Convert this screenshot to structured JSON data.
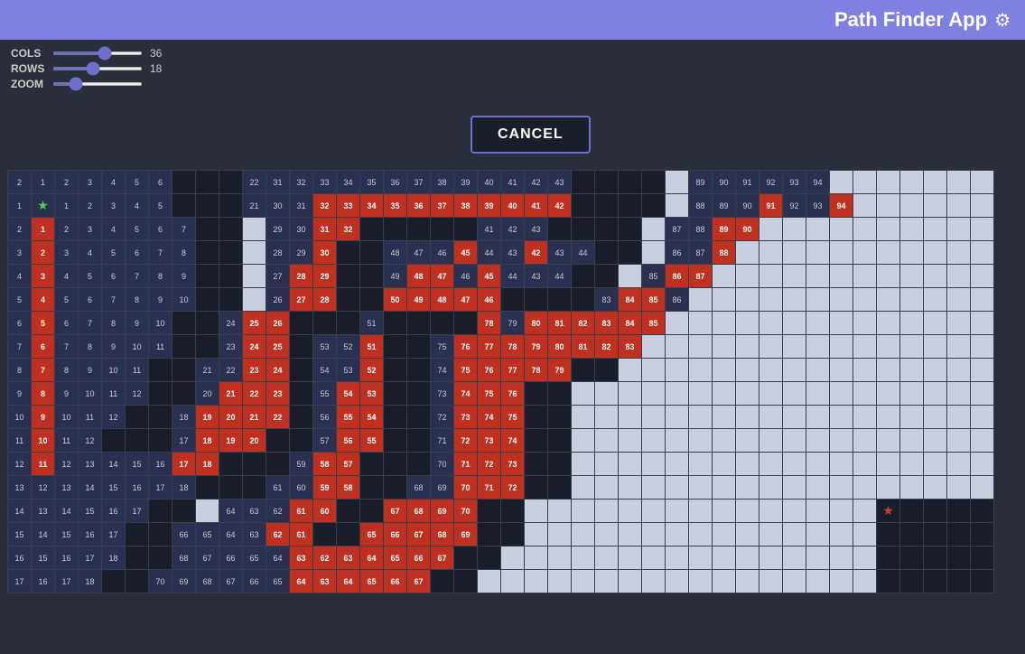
{
  "header": {
    "title": "Path Finder App",
    "gear_icon": "⚙"
  },
  "controls": {
    "cols_label": "COLS",
    "cols_value": "36",
    "cols_min": 1,
    "cols_max": 60,
    "rows_label": "ROWS",
    "rows_value": "18",
    "rows_min": 1,
    "rows_max": 40,
    "zoom_label": "ZOOM",
    "zoom_value": "50"
  },
  "cancel_button": {
    "label": "CANCEL"
  }
}
